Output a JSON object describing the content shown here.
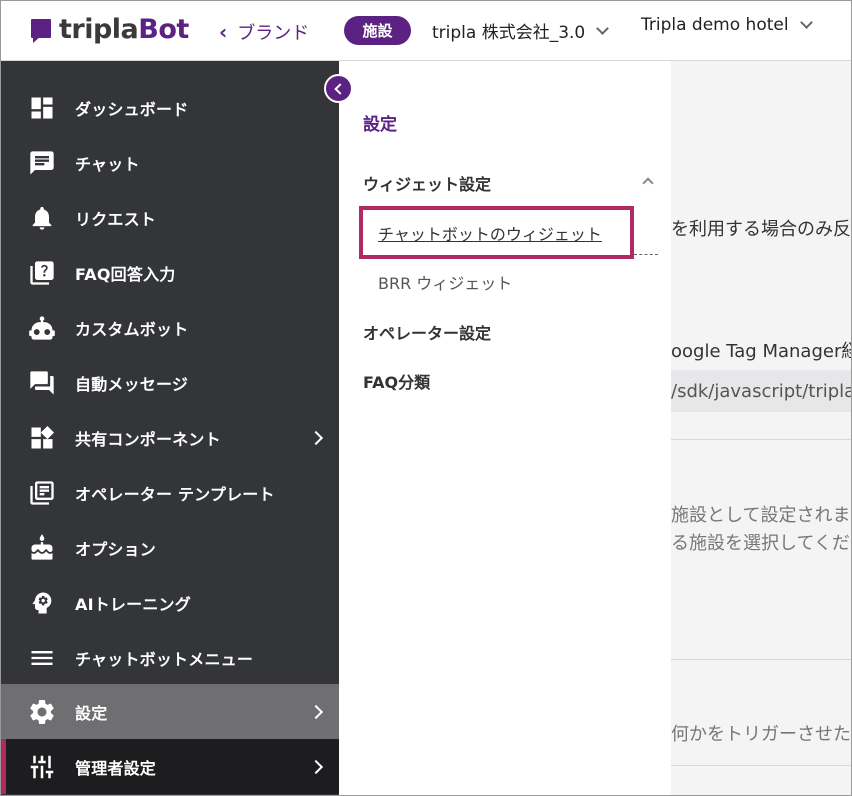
{
  "header": {
    "logo_text_a": "tripla",
    "logo_text_b": "Bot",
    "back_label": "ブランド",
    "facility_badge": "施設",
    "company_select": "tripla 株式会社_3.0",
    "hotel_select": "Tripla demo hotel"
  },
  "sidebar": {
    "items": [
      {
        "label": "ダッシュボード",
        "icon": "dashboard-icon"
      },
      {
        "label": "チャット",
        "icon": "chat-icon"
      },
      {
        "label": "リクエスト",
        "icon": "bell-icon"
      },
      {
        "label": "FAQ回答入力",
        "icon": "faq-icon"
      },
      {
        "label": "カスタムボット",
        "icon": "robot-icon"
      },
      {
        "label": "自動メッセージ",
        "icon": "forum-icon"
      },
      {
        "label": "共有コンポーネント",
        "icon": "widgets-icon"
      },
      {
        "label": "オペレーター テンプレート",
        "icon": "library-icon"
      },
      {
        "label": "オプション",
        "icon": "cake-icon"
      },
      {
        "label": "AIトレーニング",
        "icon": "ai-brain-icon"
      },
      {
        "label": "チャットボットメニュー",
        "icon": "menu-icon"
      },
      {
        "label": "設定",
        "icon": "gear-icon"
      },
      {
        "label": "管理者設定",
        "icon": "sliders-icon"
      }
    ]
  },
  "subpanel": {
    "title": "設定",
    "group_label": "ウィジェット設定",
    "sub_items": [
      "チャットボットのウィジェット",
      "BRR ウィジェット"
    ],
    "items": [
      "オペレーター設定",
      "FAQ分類"
    ]
  },
  "main": {
    "line1": "を利用する場合のみ反",
    "line2": "oogle Tag Manager経",
    "code": "/sdk/javascript/tripla.",
    "line3": "施設として設定されま",
    "line4": "る施設を選択してくだ",
    "line5": "何かをトリガーさせた"
  },
  "colors": {
    "brand_purple": "#5b2283",
    "sidebar_bg": "#343539",
    "highlight": "#b02a63"
  }
}
